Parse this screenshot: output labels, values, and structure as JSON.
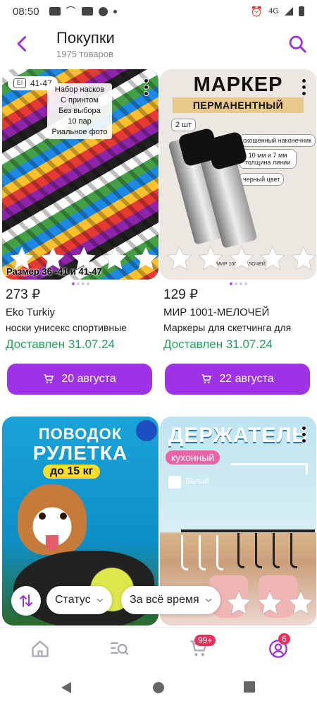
{
  "status_bar": {
    "time": "08:50",
    "network": "4G"
  },
  "header": {
    "title": "Покупки",
    "subtitle": "1975 товаров"
  },
  "products": [
    {
      "image_badge": "41-47",
      "image_note": [
        "Набор насков",
        "С принтом",
        "Без выбора",
        "10 пар",
        "Риальное фото"
      ],
      "image_caption": "Размер 36 -41 и 41-47",
      "price": "273 ₽",
      "brand": "Eko Turkiy",
      "name": "носки унисекс спортивные",
      "status": "Доставлен 31.07.24",
      "button": "20 августа"
    },
    {
      "image_title": "МАРКЕР",
      "image_subtitle": "ПЕРМАНЕНТНЫЙ",
      "image_pack": "2 шт",
      "image_pills": [
        "скошенный наконечник",
        "10 мм и 7 мм толщина линии",
        "черный цвет"
      ],
      "image_foot": "МИР 1001 МЕЛОЧЕЙ",
      "price": "129 ₽",
      "brand": "МИР 1001-МЕЛОЧЕЙ",
      "name": "Маркеры для скетчинга для",
      "status": "Доставлен 31.07.24",
      "button": "22 августа"
    },
    {
      "image_title_1": "ПОВОДОК",
      "image_title_2": "РУЛЕТКА",
      "image_tag": "до 15 кг"
    },
    {
      "image_title": "ДЕРЖАТЕЛЬ",
      "image_tag": "кухонный",
      "image_option": "Белый"
    }
  ],
  "filters": {
    "status_label": "Статус",
    "period_label": "За всё время"
  },
  "bottom_nav": {
    "cart_badge": "99+",
    "profile_badge": "6"
  }
}
